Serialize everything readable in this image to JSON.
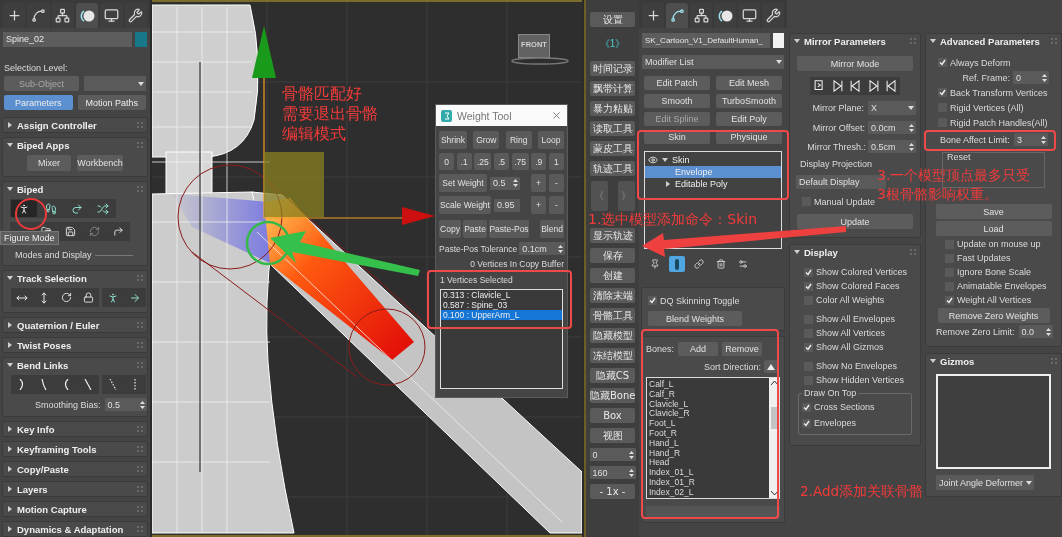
{
  "left_panel": {
    "command_tabs": [
      {
        "kind": "create",
        "selected": false
      },
      {
        "kind": "modify",
        "selected": false
      },
      {
        "kind": "hierarchy",
        "selected": false
      },
      {
        "kind": "motion",
        "selected": true
      },
      {
        "kind": "display",
        "selected": false
      },
      {
        "kind": "utilities",
        "selected": false
      }
    ],
    "object_name": "Spine_02",
    "selection_level_label": "Selection Level:",
    "sub_object_button": {
      "label": "Sub-Object",
      "disabled": true
    },
    "mode_tabs": [
      {
        "label": "Parameters",
        "selected": true
      },
      {
        "label": "Motion Paths",
        "selected": false
      }
    ],
    "rollouts": [
      {
        "title": "Assign Controller",
        "expanded": false
      },
      {
        "title": "Biped Apps",
        "expanded": true,
        "kind": "buttons",
        "buttons": [
          "Mixer",
          "Workbench"
        ]
      },
      {
        "title": "Biped",
        "expanded": true,
        "kind": "biped",
        "tools": [
          {
            "kind": "figure",
            "selected": true
          },
          {
            "kind": "footsteps",
            "selected": false
          },
          {
            "kind": "motion-flow",
            "selected": false
          },
          {
            "kind": "mixer",
            "selected": false
          }
        ],
        "tooltip": "Figure Mode",
        "subgroup": "Modes and Display"
      },
      {
        "title": "Track Selection",
        "expanded": true,
        "kind": "track"
      },
      {
        "title": "Quaternion / Euler",
        "expanded": false
      },
      {
        "title": "Twist Poses",
        "expanded": false
      },
      {
        "title": "Bend Links",
        "expanded": true,
        "kind": "bend",
        "field_label": "Smoothing Bias:",
        "field_value": "0.5"
      },
      {
        "title": "Key Info",
        "expanded": false
      },
      {
        "title": "Keyframing Tools",
        "expanded": false
      },
      {
        "title": "Copy/Paste",
        "expanded": false
      },
      {
        "title": "Layers",
        "expanded": false
      },
      {
        "title": "Motion Capture",
        "expanded": false
      },
      {
        "title": "Dynamics & Adaptation",
        "expanded": false
      }
    ]
  },
  "viewport": {
    "viewcube_label": "FRONT"
  },
  "weight_tool": {
    "title": "Weight Tool",
    "select_buttons": [
      "Shrink",
      "Grow",
      "Ring",
      "Loop"
    ],
    "presets": [
      "0",
      ".1",
      ".25",
      ".5",
      ".75",
      ".9",
      "1"
    ],
    "set_weight": {
      "label": "Set Weight",
      "value": "0.5",
      "plus": "+",
      "minus": "-"
    },
    "scale_weight": {
      "label": "Scale Weight",
      "value": "0.95",
      "plus": "+",
      "minus": "-"
    },
    "clip_buttons": [
      "Copy",
      "Paste",
      "Paste-Pos",
      "Blend"
    ],
    "tolerance_label": "Paste-Pos Tolerance",
    "tolerance_value": "0.1cm",
    "buffer_status": "0 Vertices In Copy Buffer",
    "selection_status": "1 Vertices Selected",
    "weights": [
      {
        "label": "0.313 : Clavicle_L",
        "selected": false
      },
      {
        "label": "0.587 : Spine_03",
        "selected": false
      },
      {
        "label": "0.100 : UpperArm_L",
        "selected": true
      }
    ]
  },
  "tool_column": [
    {
      "kind": "button",
      "label": "设置"
    },
    {
      "kind": "tag",
      "label": "《1》"
    },
    {
      "kind": "button",
      "label": "时间记录"
    },
    {
      "kind": "button",
      "label": "飘带计算"
    },
    {
      "kind": "button",
      "label": "暴力粘贴"
    },
    {
      "kind": "button",
      "label": "读取工具"
    },
    {
      "kind": "button",
      "label": "蒙皮工具"
    },
    {
      "kind": "button",
      "label": "轨迹工具"
    },
    {
      "kind": "pager",
      "labels": [
        "《",
        "》"
      ]
    },
    {
      "kind": "button",
      "label": "显示轨迹"
    },
    {
      "kind": "button",
      "label": "保存"
    },
    {
      "kind": "button",
      "label": "创建"
    },
    {
      "kind": "button",
      "label": "清除末端"
    },
    {
      "kind": "button",
      "label": "骨骼工具"
    },
    {
      "kind": "button",
      "label": "隐藏模型"
    },
    {
      "kind": "button",
      "label": "冻结模型"
    },
    {
      "kind": "button",
      "label": "隐藏CS"
    },
    {
      "kind": "button",
      "label": "隐藏Bone"
    },
    {
      "kind": "button",
      "label": "Box"
    },
    {
      "kind": "button",
      "label": "视图"
    },
    {
      "kind": "spinner",
      "value": "0"
    },
    {
      "kind": "spinner",
      "value": "160"
    },
    {
      "kind": "button",
      "label": "- 1x -"
    }
  ],
  "modifier_panel": {
    "command_tabs": [
      {
        "kind": "create",
        "selected": false
      },
      {
        "kind": "modify",
        "selected": true
      },
      {
        "kind": "hierarchy",
        "selected": false
      },
      {
        "kind": "motion",
        "selected": false
      },
      {
        "kind": "display",
        "selected": false
      },
      {
        "kind": "utilities",
        "selected": false
      }
    ],
    "object_name": "SK_Cartoon_V1_DefaultHuman_",
    "modifier_list": "Modifier List",
    "modifier_buttons": [
      {
        "label": "Edit Patch",
        "disabled": false
      },
      {
        "label": "Edit Mesh",
        "disabled": false
      },
      {
        "label": "Smooth",
        "disabled": false
      },
      {
        "label": "TurboSmooth",
        "disabled": false
      },
      {
        "label": "Edit Spline",
        "disabled": true
      },
      {
        "label": "Edit Poly",
        "disabled": false
      },
      {
        "label": "Skin",
        "disabled": false
      },
      {
        "label": "Physique",
        "disabled": false
      }
    ],
    "stack": [
      {
        "label": "Skin",
        "kind": "modifier",
        "expanded": true,
        "selected": false,
        "children": [
          {
            "label": "Envelope",
            "selected": true
          }
        ]
      },
      {
        "label": "Editable Poly",
        "kind": "base",
        "expanded": false,
        "selected": false
      }
    ],
    "stack_tools": [
      {
        "kind": "pin",
        "selected": false
      },
      {
        "kind": "end-result",
        "selected": true
      },
      {
        "kind": "unique",
        "selected": false
      },
      {
        "kind": "remove",
        "selected": false
      },
      {
        "kind": "configure",
        "selected": false
      }
    ],
    "dq_toggle": {
      "label": "DQ Skinning Toggle",
      "checked": true
    },
    "blend_weights": "Blend Weights",
    "bones_label": "Bones:",
    "add": "Add",
    "remove": "Remove",
    "sort_label": "Sort Direction:",
    "bones": [
      "Calf_L",
      "Calf_R",
      "Clavicle_L",
      "Clavicle_R",
      "Foot_L",
      "Foot_R",
      "Hand_L",
      "Hand_R",
      "Head",
      "Index_01_L",
      "Index_01_R",
      "Index_02_L"
    ]
  },
  "mirror_panel": {
    "title": "Mirror Parameters",
    "expanded": true,
    "mirror_mode": "Mirror Mode",
    "plane_label": "Mirror Plane:",
    "plane_value": "X",
    "offset_label": "Mirror Offset:",
    "offset_value": "0.0cm",
    "thresh_label": "Mirror Thresh.:",
    "thresh_value": "0.5cm",
    "projection_label": "Display Projection",
    "projection_value": "Default Display",
    "manual_update": {
      "label": "Manual Update",
      "checked": false
    },
    "update": "Update"
  },
  "display_panel": {
    "title": "Display",
    "expanded": true,
    "options": [
      {
        "label": "Show Colored Vertices",
        "checked": true
      },
      {
        "label": "Show Colored Faces",
        "checked": true
      },
      {
        "label": "Color All Weights",
        "checked": false
      },
      {
        "label": "Show All Envelopes",
        "checked": false
      },
      {
        "label": "Show All Vertices",
        "checked": false
      },
      {
        "label": "Show All Gizmos",
        "checked": true
      },
      {
        "label": "Show No Envelopes",
        "checked": false
      },
      {
        "label": "Show Hidden Vertices",
        "checked": false
      }
    ],
    "draw_on_top": {
      "title": "Draw On Top",
      "options": [
        {
          "label": "Cross Sections",
          "checked": true
        },
        {
          "label": "Envelopes",
          "checked": true
        }
      ]
    }
  },
  "advanced_panel": {
    "title": "Advanced Parameters",
    "expanded": true,
    "always_deform": {
      "label": "Always Deform",
      "checked": true
    },
    "ref_frame_label": "Ref. Frame:",
    "ref_frame_value": "0",
    "rigid_options": [
      {
        "label": "Back Transform Vertices",
        "checked": true
      },
      {
        "label": "Rigid Vertices (All)",
        "checked": false
      },
      {
        "label": "Rigid Patch Handles(All)",
        "checked": false
      }
    ],
    "bone_limit_label": "Bone Affect Limit:",
    "bone_limit_value": "3",
    "reset_label": "Reset",
    "save": "Save",
    "load": "Load",
    "options": [
      {
        "label": "Update on mouse up",
        "checked": false
      },
      {
        "label": "Fast Updates",
        "checked": false
      },
      {
        "label": "Ignore Bone Scale",
        "checked": false
      },
      {
        "label": "Animatable Envelopes",
        "checked": false
      },
      {
        "label": "Weight All Vertices",
        "checked": true
      }
    ],
    "remove_zero_weights": "Remove Zero Weights",
    "remove_zero_label": "Remove Zero Limit:",
    "remove_zero_value": "0.0"
  },
  "gizmos_panel": {
    "title": "Gizmos",
    "expanded": true,
    "deformer": "Joint Angle Deformer"
  },
  "notes": [
    {
      "kind": "figure-mode",
      "lines": [
        "骨骼匹配好",
        "需要退出骨骼",
        "编辑模式"
      ]
    },
    {
      "kind": "add-skin",
      "lines": [
        "1.选中模型添加命令：Skin"
      ]
    },
    {
      "kind": "add-bones",
      "lines": [
        "2.Add添加关联骨骼"
      ]
    },
    {
      "kind": "bone-limit",
      "lines": [
        "3.一个模型顶点最多只受",
        "3根骨骼影响权重。"
      ]
    }
  ]
}
